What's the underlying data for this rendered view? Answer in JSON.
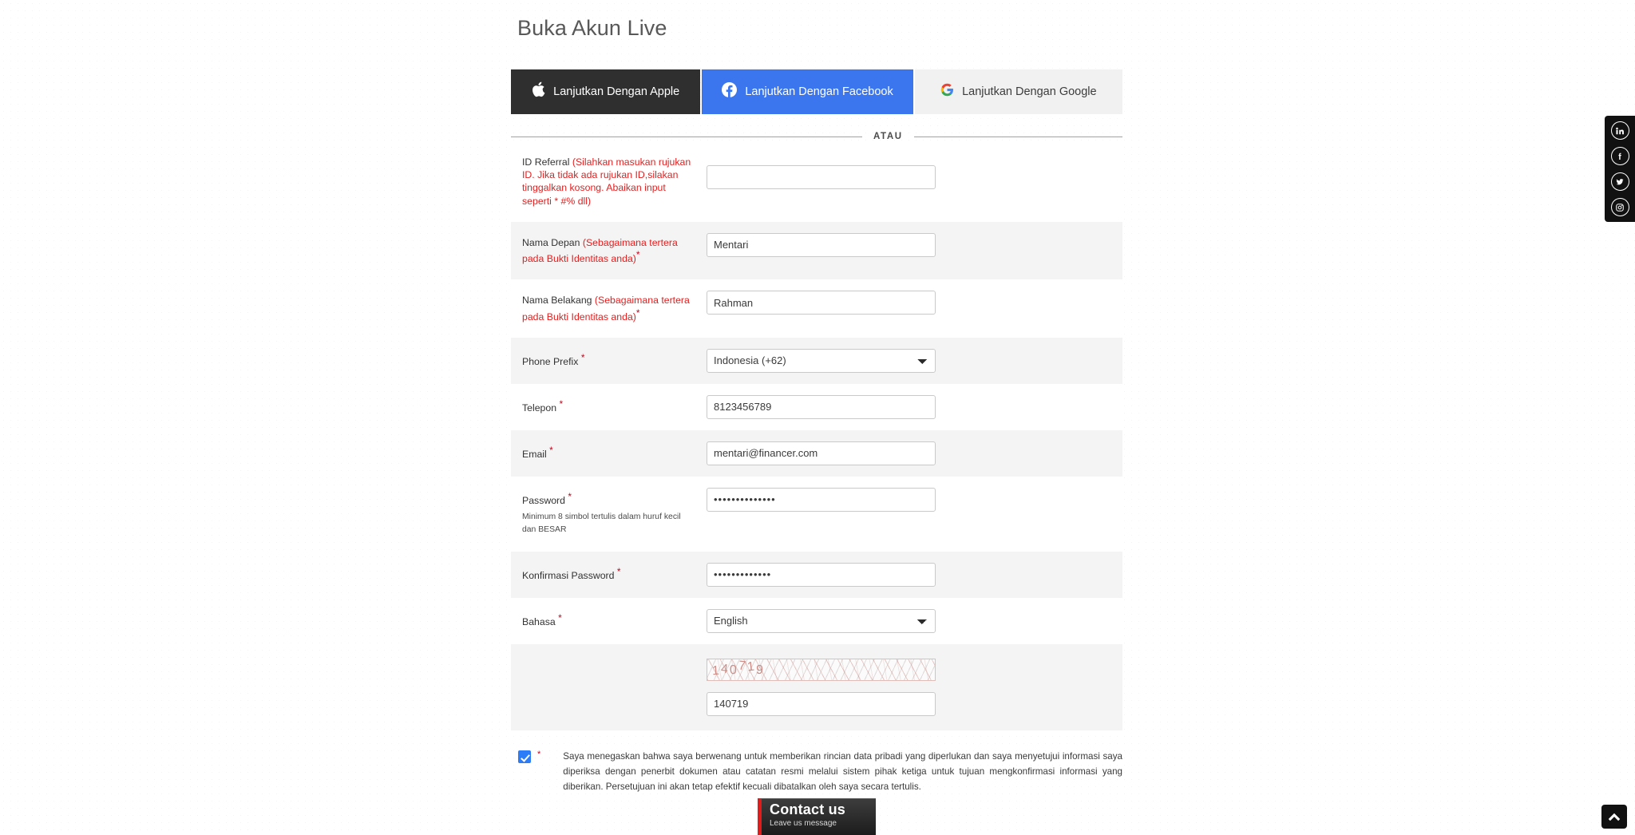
{
  "page": {
    "title": "Buka Akun Live"
  },
  "social_login": {
    "apple": {
      "label": "Lanjutkan Dengan Apple",
      "icon": "apple-icon",
      "bg": "#2f2f2f",
      "fg": "#ffffff"
    },
    "facebook": {
      "label": "Lanjutkan Dengan Facebook",
      "icon": "facebook-icon",
      "bg": "#3b76ef",
      "fg": "#ffffff"
    },
    "google": {
      "label": "Lanjutkan Dengan Google",
      "icon": "google-icon",
      "bg": "#f1f1f1",
      "fg": "#3c3c3c"
    }
  },
  "divider": {
    "text": "ATAU",
    "line_color": "#d58d86"
  },
  "form": {
    "required_marker": "*",
    "rows": {
      "referral": {
        "label_main": "ID Referral ",
        "label_note": "(Silahkan masukan rujukan ID. Jika tidak ada rujukan ID,silakan tinggalkan kosong. Abaikan input seperti * #% dll)",
        "value": "",
        "placeholder": ""
      },
      "first_name": {
        "label_main": "Nama Depan ",
        "label_note": "(Sebagaimana tertera pada Bukti Identitas anda)",
        "value": "Mentari"
      },
      "last_name": {
        "label_main": "Nama Belakang ",
        "label_note": "(Sebagaimana tertera pada Bukti Identitas anda)",
        "value": "Rahman"
      },
      "phone_prefix": {
        "label_main": "Phone Prefix",
        "value": "Indonesia (+62)",
        "options": [
          "Indonesia (+62)"
        ]
      },
      "phone": {
        "label_main": "Telepon",
        "value": "8123456789"
      },
      "email": {
        "label_main": "Email",
        "value": "mentari@financer.com"
      },
      "password": {
        "label_main": "Password",
        "hint": "Minimum 8 simbol tertulis dalam huruf kecil dan BESAR",
        "value": "••••••••••••••"
      },
      "confirm_password": {
        "label_main": "Konfirmasi Password",
        "value": "•••••••••••••"
      },
      "language": {
        "label_main": "Bahasa",
        "value": "English",
        "options": [
          "English"
        ]
      },
      "captcha": {
        "image_code": "140719",
        "value": "140719"
      }
    }
  },
  "terms": {
    "text": "Saya menegaskan bahwa saya berwenang untuk memberikan rincian data pribadi yang diperlukan dan saya menyetujui informasi saya diperiksa dengan penerbit dokumen atau catatan resmi melalui sistem pihak ketiga untuk tujuan mengkonfirmasi informasi yang diberikan. Persetujuan ini akan tetap efektif kecuali dibatalkan oleh saya secara tertulis.",
    "checked": true,
    "required_marker": "*"
  },
  "contact_widget": {
    "title": "Contact us",
    "subtitle": "Leave us message",
    "accent": "#e21b1b"
  },
  "social_rail": {
    "items": [
      {
        "name": "linkedin-icon",
        "label": "in"
      },
      {
        "name": "facebook-icon",
        "label": "f"
      },
      {
        "name": "twitter-icon",
        "label": "t"
      },
      {
        "name": "instagram-icon",
        "label": "ig"
      }
    ]
  },
  "scroll_top": {
    "icon": "chevron-up-icon"
  }
}
